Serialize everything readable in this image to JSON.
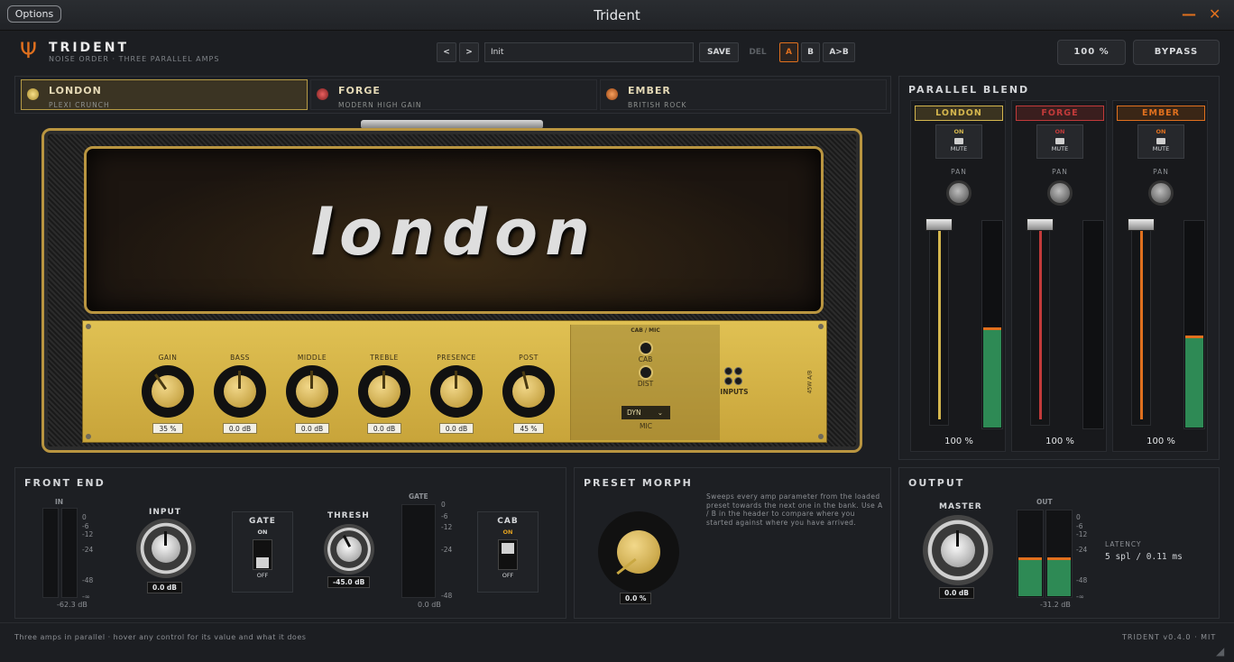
{
  "window": {
    "options_label": "Options",
    "title": "Trident"
  },
  "header": {
    "brand": "TRIDENT",
    "brand_sub": "NOISE ORDER · THREE PARALLEL AMPS",
    "prev": "<",
    "next": ">",
    "preset_name": "Init",
    "save": "SAVE",
    "del": "DEL",
    "a": "A",
    "b": "B",
    "ab": "A>B",
    "zoom": "100 %",
    "bypass": "BYPASS"
  },
  "amps": [
    {
      "name": "LONDON",
      "sub": "PLEXI CRUNCH",
      "led": "#e8c95a"
    },
    {
      "name": "FORGE",
      "sub": "MODERN HIGH GAIN",
      "led": "#c23a3a"
    },
    {
      "name": "EMBER",
      "sub": "BRITISH ROCK",
      "led": "#e0701e"
    }
  ],
  "amp_head": {
    "script": "london",
    "knobs": [
      {
        "label": "GAIN",
        "value": "35 %",
        "angle": -35
      },
      {
        "label": "BASS",
        "value": "0.0 dB",
        "angle": 0
      },
      {
        "label": "MIDDLE",
        "value": "0.0 dB",
        "angle": 0
      },
      {
        "label": "TREBLE",
        "value": "0.0 dB",
        "angle": 0
      },
      {
        "label": "PRESENCE",
        "value": "0.0 dB",
        "angle": 0
      },
      {
        "label": "POST",
        "value": "45 %",
        "angle": -14
      }
    ],
    "cab_mic": "CAB / MIC",
    "cab": "CAB",
    "dist": "DIST",
    "mic_type": "DYN",
    "mic": "MIC",
    "inputs": "INPUTS",
    "side_label": "45W A/B"
  },
  "blend": {
    "title": "PARALLEL BLEND",
    "on": "ON",
    "mute": "MUTE",
    "pan": "PAN",
    "channels": [
      {
        "name": "LONDON",
        "color": "#d4b64e",
        "bg": "#3a3320",
        "pct": "100 %",
        "level": 0.48,
        "fader": 0.99
      },
      {
        "name": "FORGE",
        "color": "#c23a3a",
        "bg": "#3a1e1e",
        "pct": "100 %",
        "level": 0,
        "fader": 0.99
      },
      {
        "name": "EMBER",
        "color": "#e0701e",
        "bg": "#3a2616",
        "pct": "100 %",
        "level": 0.44,
        "fader": 0.99
      }
    ]
  },
  "front_end": {
    "title": "FRONT END",
    "in": "IN",
    "scale": [
      "0",
      "-6",
      "-12",
      "-24",
      "-48",
      "-∞"
    ],
    "in_value": "-62.3 dB",
    "input_label": "INPUT",
    "input_value": "0.0 dB",
    "gate_label": "GATE",
    "gate_on": "ON",
    "gate_off": "OFF",
    "thresh_label": "THRESH",
    "thresh_value": "-45.0 dB",
    "gate_meter_label": "GATE",
    "gate_scale": [
      "0",
      "-6",
      "-12",
      "-24",
      "-48"
    ],
    "gate_value": "0.0 dB",
    "cab_label": "CAB",
    "cab_on": "ON",
    "cab_off": "OFF"
  },
  "morph": {
    "title": "PRESET MORPH",
    "value": "0.0 %",
    "desc": "Sweeps every amp parameter from the loaded preset towards the next one in the bank. Use A / B in the header to compare where you started against where you have arrived."
  },
  "output": {
    "title": "OUTPUT",
    "master": "MASTER",
    "master_value": "0.0 dB",
    "out": "OUT",
    "scale": [
      "0",
      "-6",
      "-12",
      "-24",
      "-48",
      "-∞"
    ],
    "out_value": "-31.2 dB",
    "latency_label": "LATENCY",
    "latency": "5 spl / 0.11 ms",
    "out_level": 0.44
  },
  "footer": {
    "left": "Three amps in parallel  ·  hover any control for its value and what it does",
    "right": "TRIDENT v0.4.0  ·  MIT"
  },
  "colors": {
    "accent": "#e0701e",
    "gold": "#c9a842",
    "meter_green": "#2e8a55"
  }
}
